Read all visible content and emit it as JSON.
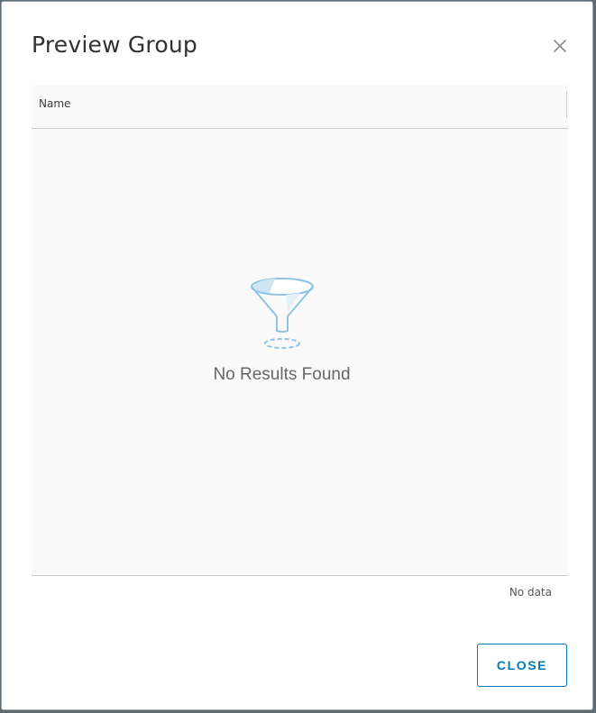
{
  "dialog": {
    "title": "Preview Group",
    "close_icon": "close-icon"
  },
  "grid": {
    "columns": [
      {
        "label": "Name"
      }
    ],
    "rows": [],
    "empty_icon": "filter-funnel-icon",
    "empty_message": "No Results Found",
    "footer_text": "No data"
  },
  "actions": {
    "close_label": "CLOSE"
  },
  "colors": {
    "accent": "#0079b8",
    "funnel_light": "#cfe4f2",
    "funnel_stroke": "#8fc3e3"
  }
}
